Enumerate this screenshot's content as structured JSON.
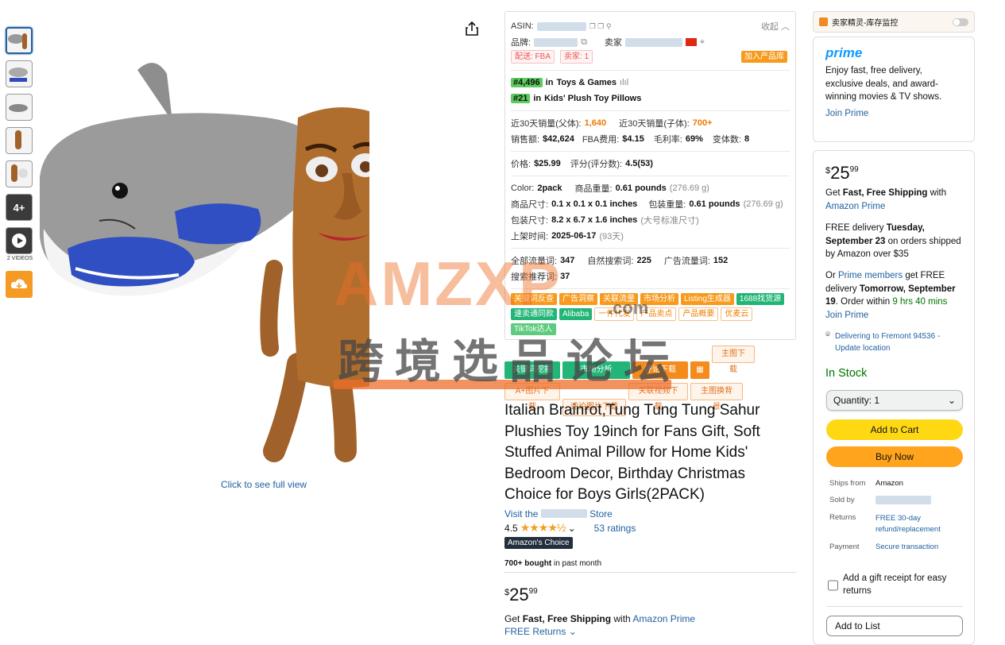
{
  "gallery": {
    "videos_label": "2 VIDEOS",
    "more_label": "4+",
    "click_full": "Click to see full view"
  },
  "ext": {
    "asin_label": "ASIN:",
    "collapse": "收起",
    "brand_label": "品牌:",
    "seller_label": "卖家",
    "ship_tag": "配送: FBA",
    "seller_tag": "卖家: 1",
    "add_lib": "加入产品库",
    "rank1": "#4,496",
    "rank1_in": "in",
    "rank1_cat": "Toys & Games",
    "rank2": "#21",
    "rank2_in": "in",
    "rank2_cat": "Kids' Plush Toy Pillows",
    "sales_parent_label": "近30天销量(父体):",
    "sales_parent": "1,640",
    "sales_child_label": "近30天销量(子体):",
    "sales_child": "700+",
    "revenue_label": "销售额:",
    "revenue": "$42,624",
    "fba_label": "FBA费用:",
    "fba": "$4.15",
    "margin_label": "毛利率:",
    "margin": "69%",
    "variants_label": "变体数:",
    "variants": "8",
    "price_label": "价格:",
    "price": "$25.99",
    "rating_label": "评分(评分数):",
    "rating": "4.5(53)",
    "color_label": "Color:",
    "color": "2pack",
    "weight_label": "商品重量:",
    "weight": "0.61 pounds",
    "weight_g": "(276.69 g)",
    "size_label": "商品尺寸:",
    "size": "0.1 x 0.1 x 0.1 inches",
    "pkg_weight_label": "包装重量:",
    "pkg_weight": "0.61 pounds",
    "pkg_weight_g": "(276.69 g)",
    "pkg_size_label": "包装尺寸:",
    "pkg_size": "8.2 x 6.7 x 1.6 inches",
    "pkg_size_note": "(大号标准尺寸)",
    "listed_label": "上架时间:",
    "listed": "2025-06-17",
    "listed_days": "(93天)",
    "all_kw_label": "全部流量词:",
    "all_kw": "347",
    "organic_label": "自然搜索词:",
    "organic": "225",
    "ad_label": "广告流量词:",
    "ad": "152",
    "rec_label": "搜索推荐词:",
    "rec": "37",
    "tags": [
      "关键词反查",
      "广告洞察",
      "关联流量",
      "市场分析",
      "Listing生成器",
      "1688找货源",
      "速卖通同款",
      "Alibaba",
      "一件代发",
      "产品卖点",
      "产品概要",
      "优麦云",
      "TikTok达人"
    ]
  },
  "actions": [
    "关键词挖掘",
    "市场分析",
    "评论下载",
    "",
    "主图下载",
    "A+图片下载",
    "评论图片下载",
    "关联视频下载",
    "主图换背景"
  ],
  "product": {
    "title": "Italian Brainrot,Tung Tung Tung Sahur Plushies Toy 19inch for Fans Gift, Soft Stuffed Animal Pillow for Home Kids' Bedroom Decor, Birthday Christmas Choice for Boys Girls(2PACK)",
    "visit_prefix": "Visit the",
    "visit_suffix": "Store",
    "rating": "4.5",
    "stars": "★★★★½",
    "ratings_count": "53 ratings",
    "choice": "Amazon's Choice",
    "bought_strong": "700+ bought",
    "bought_rest": "in past month",
    "price_sym": "$",
    "price_whole": "25",
    "price_cents": "99",
    "fast_prefix": "Get",
    "fast_strong": "Fast, Free Shipping",
    "fast_with": "with",
    "fast_link": "Amazon Prime",
    "free_returns": "FREE Returns"
  },
  "seller_sprite": {
    "label": "卖家精灵-库存监控"
  },
  "prime_box": {
    "logo": "prime",
    "text": "Enjoy fast, free delivery, exclusive deals, and award-winning movies & TV shows.",
    "join": "Join Prime"
  },
  "buybox": {
    "price_sym": "$",
    "price_whole": "25",
    "price_cents": "99",
    "ship_prefix": "Get",
    "ship_strong": "Fast, Free Shipping",
    "ship_with": "with",
    "ship_link": "Amazon Prime",
    "free_delivery": "FREE delivery",
    "free_date": "Tuesday, September 23",
    "free_rest": "on orders shipped by Amazon over $35",
    "or": "Or",
    "prime_members": "Prime members",
    "get_free": "get FREE delivery",
    "tomorrow": "Tomorrow, September 19",
    "order_within": ". Order within",
    "time_left": "9 hrs 40 mins",
    "join_prime": "Join Prime",
    "deliver_to": "Delivering to Fremont 94536 - Update location",
    "stock": "In Stock",
    "quantity": "Quantity: 1",
    "add_to_cart": "Add to Cart",
    "buy_now": "Buy Now",
    "ships_from_k": "Ships from",
    "ships_from_v": "Amazon",
    "sold_by_k": "Sold by",
    "returns_k": "Returns",
    "returns_v": "FREE 30-day refund/replacement",
    "payment_k": "Payment",
    "payment_v": "Secure transaction",
    "gift": "Add a gift receipt for easy returns",
    "add_to_list": "Add to List"
  },
  "watermark": {
    "brand": "AMZXP",
    "dotcom": ".com",
    "forum": "跨境选品论坛"
  },
  "colors": {
    "link": "#2162a1",
    "orange": "#f79a1d",
    "green": "#22b577",
    "prime": "#1399ff",
    "cart": "#ffd814",
    "buy": "#ffa41c"
  }
}
